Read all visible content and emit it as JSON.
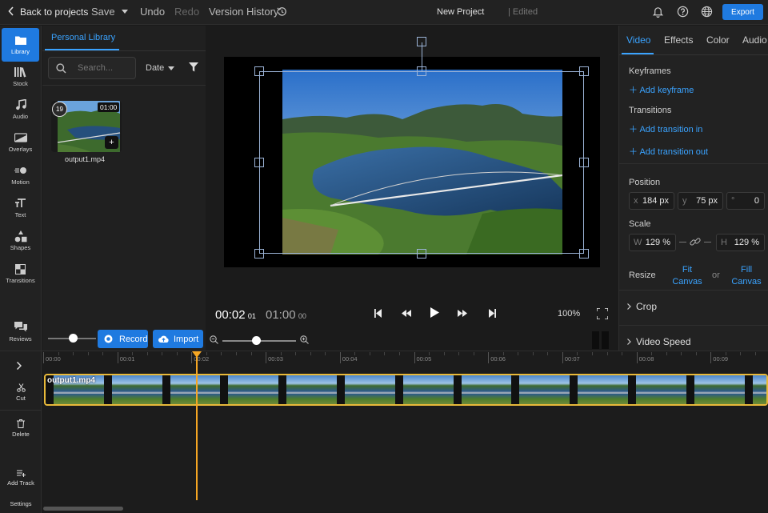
{
  "topbar": {
    "back_label": "Back to projects",
    "save_label": "Save",
    "undo_label": "Undo",
    "redo_label": "Redo",
    "version_history_label": "Version History",
    "project_title": "New Project",
    "edit_status": "| Edited",
    "export_label": "Export"
  },
  "rail": {
    "items": [
      {
        "label": "Library",
        "icon": "folder-icon",
        "active": true
      },
      {
        "label": "Stock",
        "icon": "stock-icon"
      },
      {
        "label": "Audio",
        "icon": "music-note-icon"
      },
      {
        "label": "Overlays",
        "icon": "overlays-icon"
      },
      {
        "label": "Motion",
        "icon": "motion-icon"
      },
      {
        "label": "Text",
        "icon": "text-icon"
      },
      {
        "label": "Shapes",
        "icon": "shapes-icon"
      },
      {
        "label": "Transitions",
        "icon": "transitions-icon"
      },
      {
        "label": "Reviews",
        "icon": "reviews-icon"
      }
    ]
  },
  "library": {
    "tab_label": "Personal Library",
    "search_placeholder": "Search...",
    "sort_label": "Date",
    "media": {
      "badge": "19",
      "duration": "01:00",
      "filename": "output1.mp4"
    },
    "record_label": "Record",
    "import_label": "Import"
  },
  "preview": {
    "current_time": "00:02",
    "current_frame": "01",
    "total_time": "01:00",
    "total_frame": "00",
    "zoom": "100%"
  },
  "right_panel": {
    "tabs": [
      "Video",
      "Effects",
      "Color",
      "Audio"
    ],
    "active_tab": "Video",
    "keyframes_title": "Keyframes",
    "add_keyframe": "Add keyframe",
    "transitions_title": "Transitions",
    "add_transition_in": "Add transition in",
    "add_transition_out": "Add transition out",
    "position_title": "Position",
    "pos_x_label": "x",
    "pos_x_value": "184 px",
    "pos_y_label": "y",
    "pos_y_value": "75 px",
    "rotation_label": "°",
    "rotation_value": "0",
    "scale_title": "Scale",
    "scale_w_label": "W",
    "scale_w_value": "129 %",
    "scale_h_label": "H",
    "scale_h_value": "129 %",
    "resize_title": "Resize",
    "fit_label_1": "Fit",
    "fit_label_2": "Canvas",
    "or_label": "or",
    "fill_label_1": "Fill",
    "fill_label_2": "Canvas",
    "crop_title": "Crop",
    "speed_title": "Video Speed"
  },
  "timeline": {
    "ticks": [
      "00:00",
      "00:01",
      "00:02",
      "00:03",
      "00:04",
      "00:05",
      "00:06",
      "00:07",
      "00:08",
      "00:09"
    ],
    "clip_label": "output1.mp4",
    "playhead_fraction": 0.212,
    "tools": [
      {
        "label": "Cut",
        "icon": "scissors-icon"
      },
      {
        "label": "Delete",
        "icon": "trash-icon"
      },
      {
        "label": "Add Track",
        "icon": "add-track-icon"
      },
      {
        "label": "Settings",
        "icon": "settings-icon"
      }
    ]
  },
  "colors": {
    "accent": "#1f7ae0",
    "link": "#3aa3ff",
    "playhead": "#f5a623",
    "clip_border": "#e8b93a"
  }
}
